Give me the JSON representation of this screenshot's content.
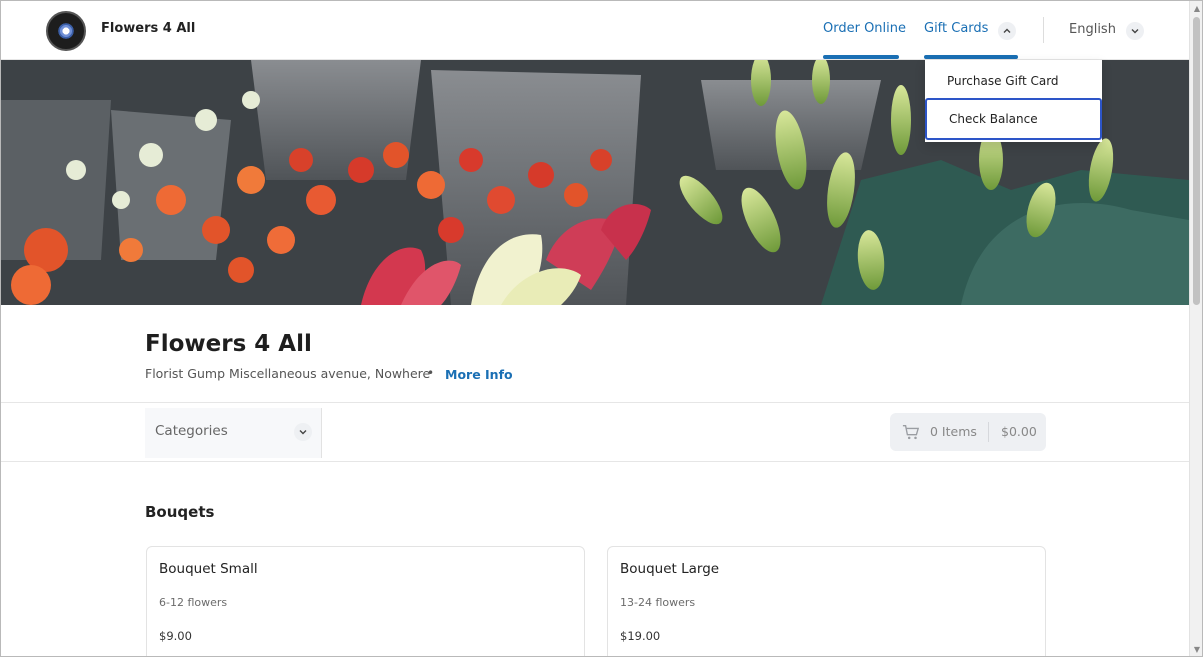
{
  "header": {
    "brand": "Flowers 4 All",
    "nav": {
      "order_online": "Order Online",
      "gift_cards": "Gift Cards",
      "language": "English"
    }
  },
  "gift_dropdown": {
    "items": [
      {
        "label": "Purchase Gift Card"
      },
      {
        "label": "Check Balance"
      }
    ]
  },
  "store": {
    "name": "Flowers 4 All",
    "address": "Florist Gump Miscellaneous avenue, Nowhere",
    "separator": "•",
    "more_info": "More Info"
  },
  "toolbar": {
    "categories_label": "Categories",
    "cart_items": "0 Items",
    "cart_total": "$0.00"
  },
  "menu": {
    "section_title": "Bouqets",
    "items": [
      {
        "name": "Bouquet Small",
        "desc": "6-12 flowers",
        "price": "$9.00"
      },
      {
        "name": "Bouquet Large",
        "desc": "13-24 flowers",
        "price": "$19.00"
      }
    ]
  },
  "colors": {
    "accent": "#1a6fb4",
    "focus_ring": "#2d55c8"
  },
  "icons": [
    "logo",
    "chevron-up-icon",
    "chevron-down-icon",
    "cart-icon"
  ]
}
